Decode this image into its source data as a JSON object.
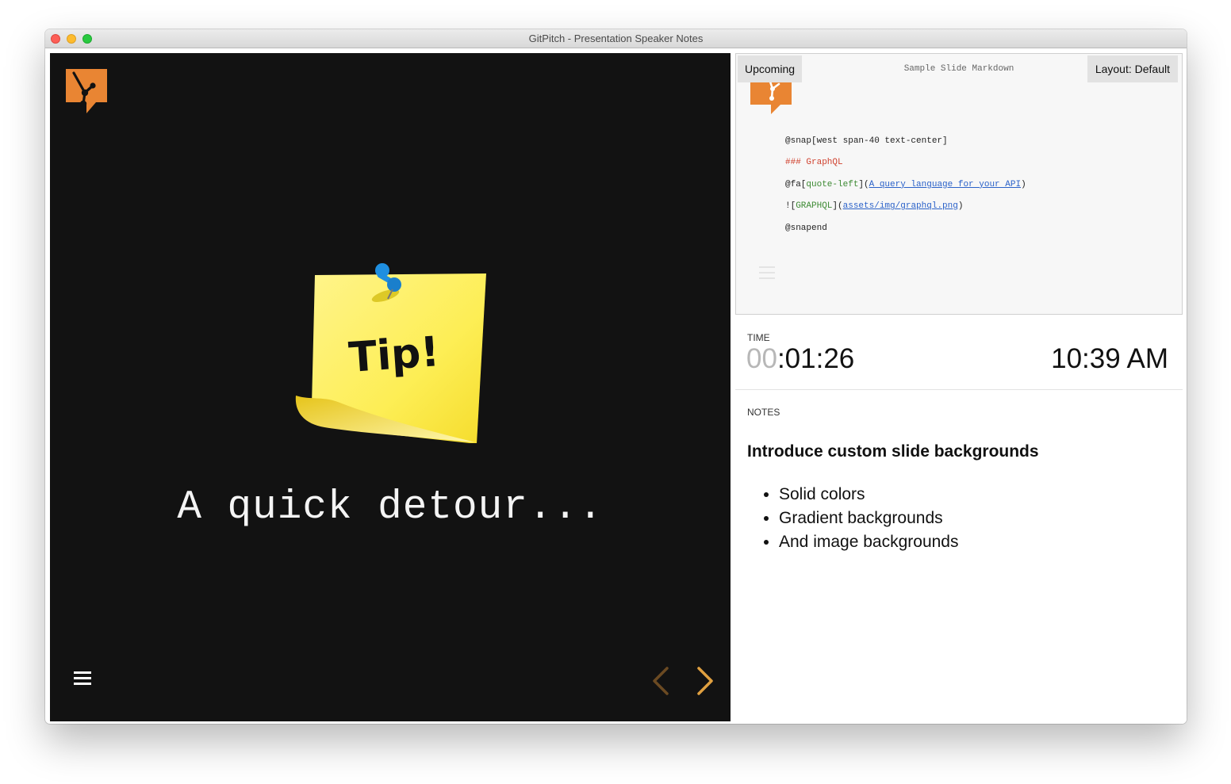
{
  "window": {
    "title": "GitPitch - Presentation Speaker Notes"
  },
  "slide": {
    "heading": "A quick detour...",
    "sticky_note_text": "Tip!"
  },
  "preview": {
    "upcoming_label": "Upcoming",
    "title": "Sample Slide Markdown",
    "layout_label": "Layout: Default",
    "code": {
      "line1": "@snap[west span-40 text-center]",
      "line2": "### GraphQL",
      "line3_prefix": "@fa[",
      "line3_icon": "quote-left",
      "line3_mid": "](",
      "line3_link": "A query language for your API",
      "line3_suffix": ")",
      "line4_prefix": "![",
      "line4_alt": "GRAPHQL",
      "line4_mid": "](",
      "line4_link": "assets/img/graphql.png",
      "line4_suffix": ")",
      "line5": "@snapend"
    }
  },
  "time": {
    "label": "TIME",
    "elapsed_hours": "00",
    "elapsed_rest": ":01:26",
    "clock": "10:39 AM"
  },
  "notes": {
    "label": "NOTES",
    "heading": "Introduce custom slide backgrounds",
    "items": [
      "Solid colors",
      "Gradient backgrounds",
      "And image backgrounds"
    ]
  },
  "colors": {
    "slide_background": "#121212",
    "accent_orange": "#e98533",
    "nav_arrow_next": "#e0a040",
    "nav_arrow_prev": "#6b4a22",
    "sticky_note": "#fdee55"
  },
  "icons": [
    "gitpitch-logo-icon",
    "hamburger-menu-icon",
    "chevron-left-icon",
    "chevron-right-icon",
    "pushpin-icon"
  ]
}
